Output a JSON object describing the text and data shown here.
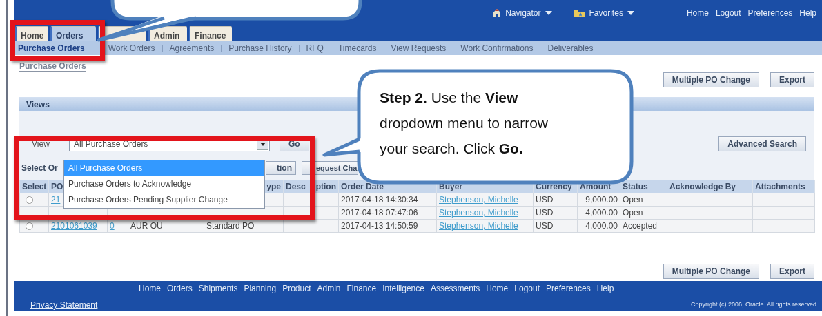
{
  "header": {
    "menus": [
      {
        "kind": "navigator",
        "label": "Navigator"
      },
      {
        "kind": "favorites",
        "label": "Favorites"
      }
    ],
    "global_links": [
      "Home",
      "Logout",
      "Preferences",
      "Help"
    ]
  },
  "tabs": [
    {
      "label": "Home",
      "selected": false
    },
    {
      "label": "Orders",
      "selected": true
    },
    {
      "selected": false
    },
    {
      "label": "Admin",
      "selected": false
    },
    {
      "label": "Finance",
      "selected": false
    }
  ],
  "subtabs": [
    {
      "label": "Purchase Orders",
      "selected": true
    },
    {
      "label": "Work Orders",
      "selected": false
    },
    {
      "label": "Agreements",
      "selected": false
    },
    {
      "label": "Purchase History",
      "selected": false
    },
    {
      "label": "RFQ",
      "selected": false
    },
    {
      "label": "Timecards",
      "selected": false
    },
    {
      "label": "View Requests",
      "selected": false
    },
    {
      "label": "Work Confirmations",
      "selected": false
    },
    {
      "label": "Deliverables",
      "selected": false
    }
  ],
  "page_title": "Purchase Orders",
  "top_buttons": [
    "Multiple PO Change",
    "Export"
  ],
  "views": {
    "title": "Views",
    "view_label": "View",
    "select_value": "All Purchase Orders",
    "go_button": "Go",
    "advanced_search": "Advanced Search",
    "dropdown_options": [
      {
        "label": "All Purchase Orders",
        "selected": true
      },
      {
        "label": "Purchase Orders to Acknowledge",
        "selected": false
      },
      {
        "label": "Purchase Orders Pending Supplier Change",
        "selected": false
      }
    ],
    "select_label": "Select Or",
    "action_buttons": [
      "tion",
      "equest Cha"
    ]
  },
  "table": {
    "headers": {
      "select": "Select",
      "po": "PO",
      "type": "ype",
      "description": [
        "Desc",
        "ption"
      ],
      "order_date": "Order Date",
      "buyer": "Buyer",
      "currency": "Currency",
      "amount": "Amount",
      "status": "Status",
      "acknowledge_by": "Acknowledge By",
      "attachments": "Attachments"
    },
    "rows": [
      {
        "selected": false,
        "po": "21",
        "order_date": "2017-04-18 14:30:34",
        "buyer": "Stephenson, Michelle",
        "currency": "USD",
        "amount": "9,000.00",
        "status": "Open"
      },
      {
        "order_date": "2017-04-18 07:47:06",
        "buyer": "Stephenson, Michelle",
        "currency": "USD",
        "amount": "4,000.00",
        "status": "Open"
      },
      {
        "selected": false,
        "po": "2101061039",
        "revision": "0",
        "operating_unit": "AUR OU",
        "type": "Standard PO",
        "order_date": "2017-04-13 14:50:59",
        "buyer": "Stephenson, Michelle",
        "currency": "USD",
        "amount": "4,000.00",
        "status": "Accepted"
      }
    ]
  },
  "bottom_buttons": [
    "Multiple PO Change",
    "Export"
  ],
  "footer": {
    "links": [
      "Home",
      "Orders",
      "Shipments",
      "Planning",
      "Product",
      "Admin",
      "Finance",
      "Intelligence",
      "Assessments",
      "Home",
      "Logout",
      "Preferences",
      "Help"
    ],
    "privacy": "Privacy Statement",
    "copyright": "Copyright (c) 2006, Oracle. All rights reserved"
  },
  "callouts": [
    {
      "kind": "pointer"
    },
    {
      "kind": "step",
      "text": "**Step 2.** Use the **View** dropdown menu to narrow your search. Click **Go.**"
    }
  ]
}
